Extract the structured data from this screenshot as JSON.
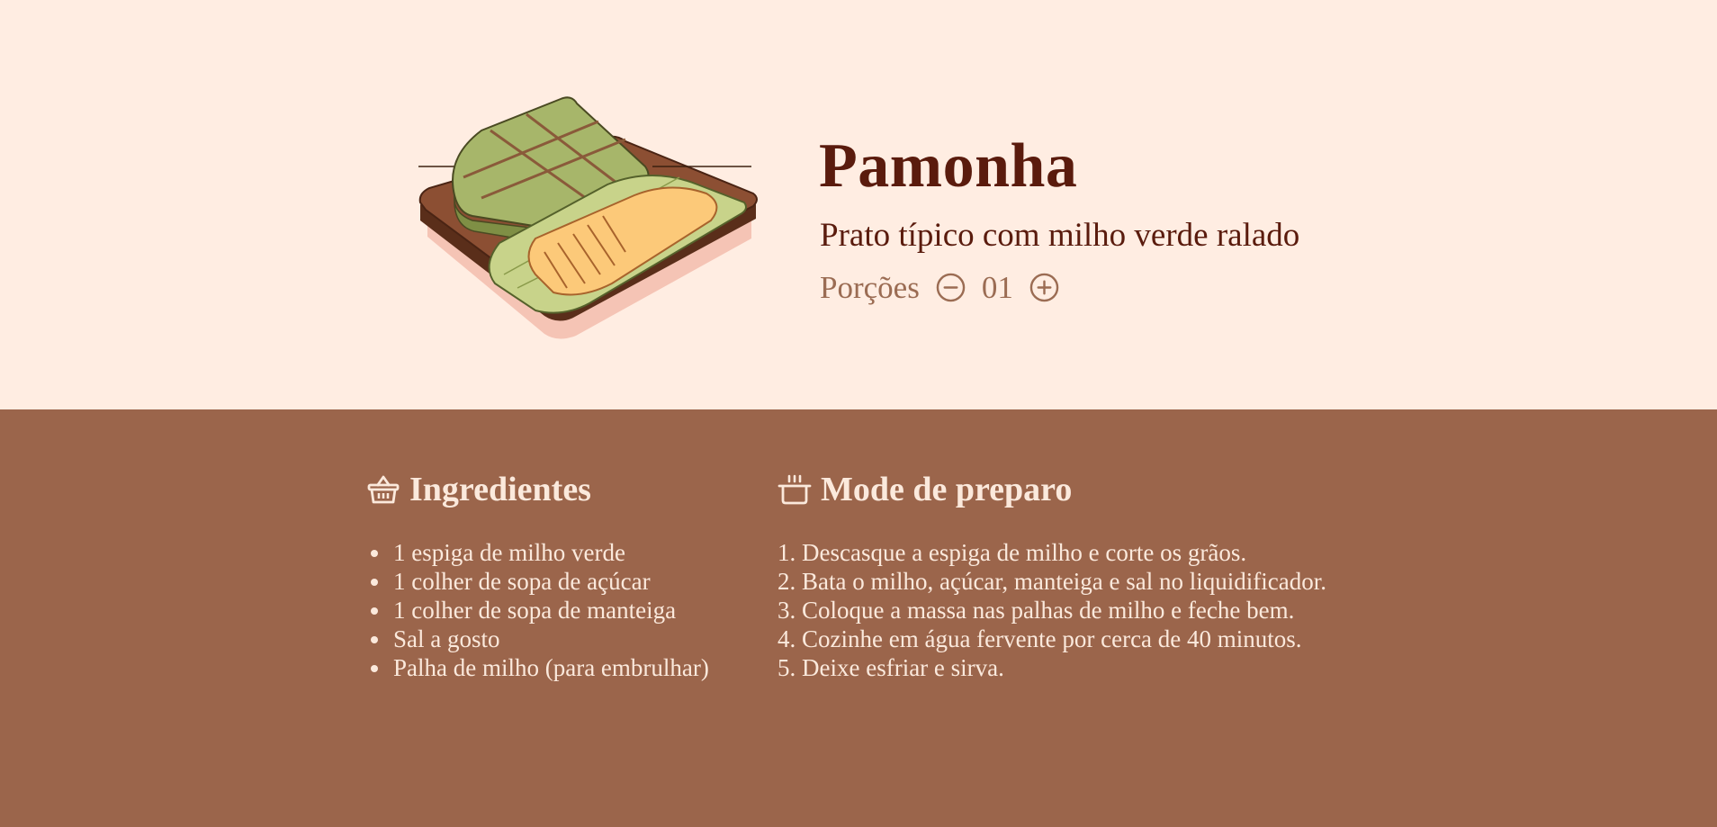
{
  "recipe": {
    "title": "Pamonha",
    "subtitle": "Prato típico com milho verde ralado",
    "servings_label": "Porções",
    "servings_value": "01",
    "image_icon": "pamonha-illustration"
  },
  "ingredients": {
    "heading": "Ingredientes",
    "icon": "basket-icon",
    "items": [
      "1 espiga de milho verde",
      "1 colher de sopa de açúcar",
      "1 colher de sopa de manteiga",
      "Sal a gosto",
      "Palha de milho (para embrulhar)"
    ]
  },
  "preparation": {
    "heading": "Mode de preparo",
    "icon": "cooking-pot-icon",
    "steps": [
      "1. Descasque a espiga de milho e corte os grãos.",
      "2. Bata o milho, açúcar, manteiga e sal no liquidificador.",
      "3. Coloque a massa nas palhas de milho e feche bem.",
      "4. Cozinhe em água fervente por cerca de 40 minutos.",
      "5. Deixe esfriar e sirva."
    ]
  },
  "colors": {
    "hero_bg": "#ffede2",
    "content_bg": "#9b654b",
    "title": "#5a1b0d",
    "muted": "#9b6c53",
    "light_text": "#fbe9dc"
  }
}
